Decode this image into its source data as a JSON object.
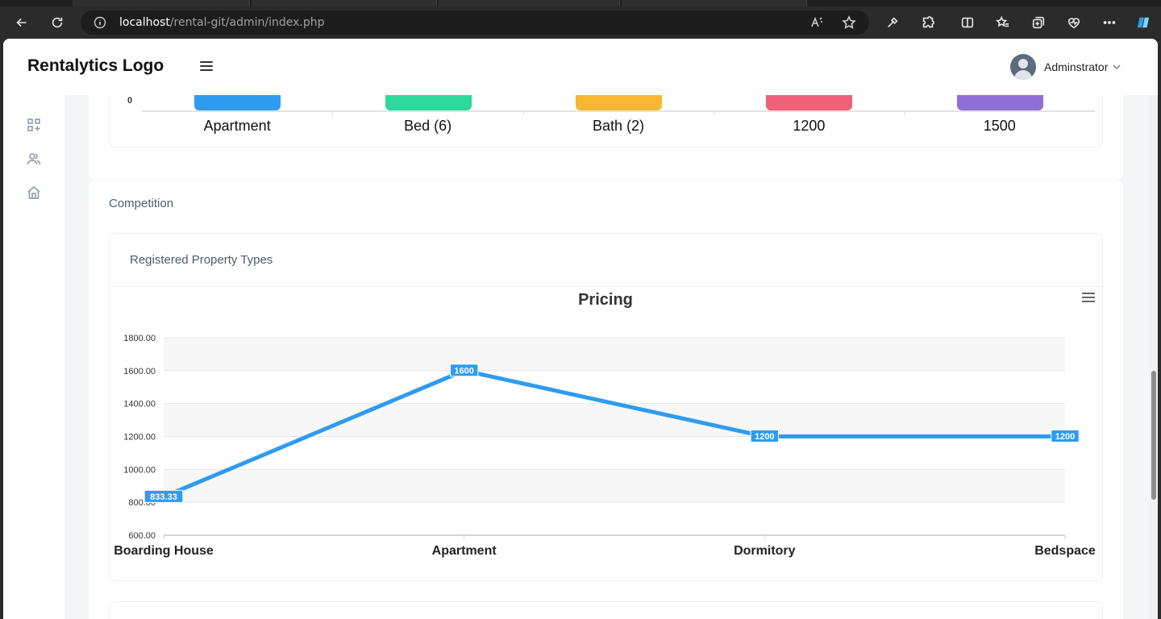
{
  "browser": {
    "url_host": "localhost",
    "url_path": "/rental-git/admin/index.php"
  },
  "header": {
    "logo": "Rentalytics Logo",
    "user_name": "Adminstrator"
  },
  "top_chart": {
    "zero_tick": "0",
    "categories": [
      "Apartment",
      "Bed (6)",
      "Bath (2)",
      "1200",
      "1500"
    ],
    "colors": [
      "#2e9bf0",
      "#2dd99b",
      "#f7b733",
      "#f0607a",
      "#8f6fd6"
    ]
  },
  "competition": {
    "title": "Competition",
    "subtitle": "Registered Property Types"
  },
  "chart_data": {
    "type": "line",
    "title": "Pricing",
    "categories": [
      "Boarding House",
      "Apartment",
      "Dormitory",
      "Bedspace"
    ],
    "y_ticks": [
      "1800.00",
      "1600.00",
      "1400.00",
      "1200.00",
      "1000.00",
      "800.00",
      "600.00"
    ],
    "ylim": [
      600,
      1800
    ],
    "series": [
      {
        "values": [
          833.33,
          1600,
          1200,
          1200
        ],
        "labels": [
          "833.33",
          "1600",
          "1200",
          "1200"
        ],
        "color": "#2e9bf0"
      }
    ],
    "grid": true,
    "menu_icon": "hamburger-icon"
  }
}
